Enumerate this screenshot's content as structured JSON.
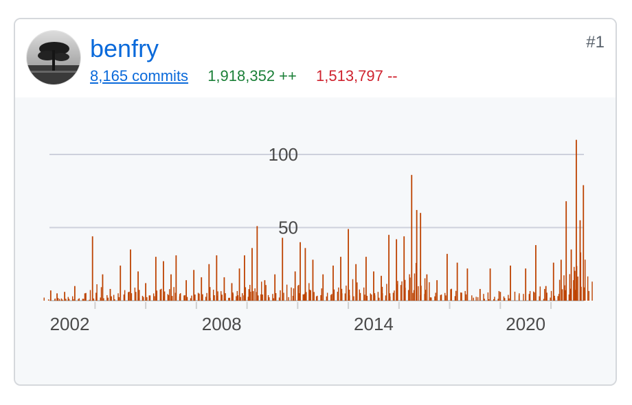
{
  "contributor": {
    "username": "benfry",
    "avatar_icon": "avatar-tree-photo",
    "commits_label": "8,165 commits",
    "additions_label": "1,918,352 ++",
    "deletions_label": "1,513,797 --",
    "rank": "#1"
  },
  "colors": {
    "link": "#0969da",
    "additions": "#1a7f37",
    "deletions": "#cf222e",
    "bars": "#bd4200"
  },
  "chart_data": {
    "type": "area",
    "title": "",
    "xlabel": "",
    "ylabel": "",
    "xlim": [
      2001.2,
      2022.3
    ],
    "ylim": [
      0,
      100
    ],
    "yticks": [
      50,
      100
    ],
    "ytick_labels": [
      "50",
      "100"
    ],
    "xticks": [
      2002,
      2008,
      2014,
      2020
    ],
    "xtick_labels": [
      "2002",
      "2008",
      "2014",
      "2020"
    ],
    "grid": true,
    "legend": "none",
    "peaks": [
      {
        "x": 2001.25,
        "y": 7
      },
      {
        "x": 2001.5,
        "y": 5
      },
      {
        "x": 2001.8,
        "y": 6
      },
      {
        "x": 2002.2,
        "y": 10
      },
      {
        "x": 2002.6,
        "y": 5
      },
      {
        "x": 2002.9,
        "y": 44
      },
      {
        "x": 2003.3,
        "y": 18
      },
      {
        "x": 2003.6,
        "y": 8
      },
      {
        "x": 2004.0,
        "y": 24
      },
      {
        "x": 2004.4,
        "y": 35
      },
      {
        "x": 2004.7,
        "y": 20
      },
      {
        "x": 2005.0,
        "y": 12
      },
      {
        "x": 2005.4,
        "y": 30
      },
      {
        "x": 2005.7,
        "y": 27
      },
      {
        "x": 2006.0,
        "y": 18
      },
      {
        "x": 2006.2,
        "y": 31
      },
      {
        "x": 2006.6,
        "y": 14
      },
      {
        "x": 2006.9,
        "y": 21
      },
      {
        "x": 2007.2,
        "y": 16
      },
      {
        "x": 2007.5,
        "y": 25
      },
      {
        "x": 2007.8,
        "y": 31
      },
      {
        "x": 2008.1,
        "y": 16
      },
      {
        "x": 2008.4,
        "y": 12
      },
      {
        "x": 2008.7,
        "y": 22
      },
      {
        "x": 2008.9,
        "y": 31
      },
      {
        "x": 2009.2,
        "y": 36
      },
      {
        "x": 2009.4,
        "y": 51
      },
      {
        "x": 2009.7,
        "y": 14
      },
      {
        "x": 2010.1,
        "y": 18
      },
      {
        "x": 2010.4,
        "y": 43
      },
      {
        "x": 2010.9,
        "y": 20
      },
      {
        "x": 2011.1,
        "y": 40
      },
      {
        "x": 2011.3,
        "y": 36
      },
      {
        "x": 2011.6,
        "y": 28
      },
      {
        "x": 2012.0,
        "y": 18
      },
      {
        "x": 2012.4,
        "y": 24
      },
      {
        "x": 2012.7,
        "y": 30
      },
      {
        "x": 2013.0,
        "y": 49
      },
      {
        "x": 2013.3,
        "y": 25
      },
      {
        "x": 2013.7,
        "y": 30
      },
      {
        "x": 2014.0,
        "y": 20
      },
      {
        "x": 2014.3,
        "y": 17
      },
      {
        "x": 2014.6,
        "y": 45
      },
      {
        "x": 2014.9,
        "y": 42
      },
      {
        "x": 2015.2,
        "y": 44
      },
      {
        "x": 2015.5,
        "y": 86
      },
      {
        "x": 2015.7,
        "y": 62
      },
      {
        "x": 2015.85,
        "y": 60
      },
      {
        "x": 2016.1,
        "y": 18
      },
      {
        "x": 2016.5,
        "y": 14
      },
      {
        "x": 2016.9,
        "y": 32
      },
      {
        "x": 2017.3,
        "y": 26
      },
      {
        "x": 2017.7,
        "y": 22
      },
      {
        "x": 2018.2,
        "y": 8
      },
      {
        "x": 2018.6,
        "y": 22
      },
      {
        "x": 2019.0,
        "y": 6
      },
      {
        "x": 2019.4,
        "y": 24
      },
      {
        "x": 2020.0,
        "y": 22
      },
      {
        "x": 2020.4,
        "y": 38
      },
      {
        "x": 2020.8,
        "y": 10
      },
      {
        "x": 2021.1,
        "y": 26
      },
      {
        "x": 2021.4,
        "y": 28
      },
      {
        "x": 2021.6,
        "y": 68
      },
      {
        "x": 2021.8,
        "y": 35
      },
      {
        "x": 2022.0,
        "y": 110
      },
      {
        "x": 2022.15,
        "y": 55
      },
      {
        "x": 2022.28,
        "y": 79
      }
    ]
  }
}
